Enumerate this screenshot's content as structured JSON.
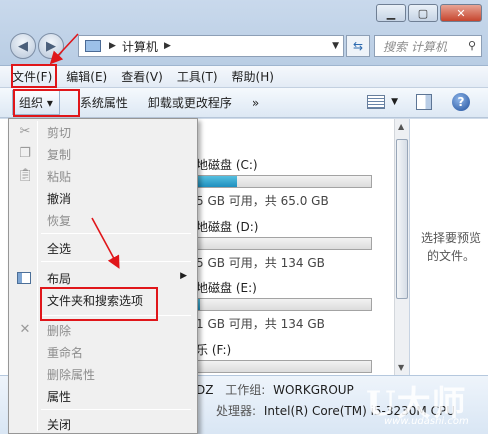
{
  "address": {
    "crumb": "计算机",
    "search_placeholder": "搜索 计算机"
  },
  "menubar": [
    "文件(F)",
    "编辑(E)",
    "查看(V)",
    "工具(T)",
    "帮助(H)"
  ],
  "commandbar": {
    "organize": "组织 ▾",
    "system_properties": "系统属性",
    "uninstall": "卸载或更改程序",
    "more": "»"
  },
  "drives": [
    {
      "name": "地磁盘 (C:)",
      "info": "5 GB 可用，共 65.0 GB",
      "fill_fraction": 0.23
    },
    {
      "name": "地磁盘 (D:)",
      "info": "5 GB 可用，共 134 GB",
      "fill_fraction": 0.0
    },
    {
      "name": "地磁盘 (E:)",
      "info": "1 GB 可用，共 134 GB",
      "fill_fraction": 0.02
    },
    {
      "name": "乐 (F:)",
      "info": "",
      "fill_fraction": 0.0
    }
  ],
  "preview_text": "选择要预览的文件。",
  "details": {
    "name_fragment": "DZ",
    "workgroup_label": "工作组:",
    "workgroup": "WORKGROUP",
    "cpu_label": "处理器:",
    "cpu": "Intel(R) Core(TM) i5-3230M CPU"
  },
  "watermark": {
    "brand": "U大师",
    "url": "www.udashi.com"
  },
  "context_menu": {
    "cut": "剪切",
    "copy": "复制",
    "paste": "粘贴",
    "undo": "撤消",
    "redo": "恢复",
    "select_all": "全选",
    "layout": "布局",
    "folder_options": "文件夹和搜索选项",
    "delete": "删除",
    "rename": "重命名",
    "remove_properties": "删除属性",
    "properties": "属性",
    "close": "关闭"
  },
  "colors": {
    "highlight_red": "#e0161a",
    "drive_bar": "#2a9ccb"
  }
}
